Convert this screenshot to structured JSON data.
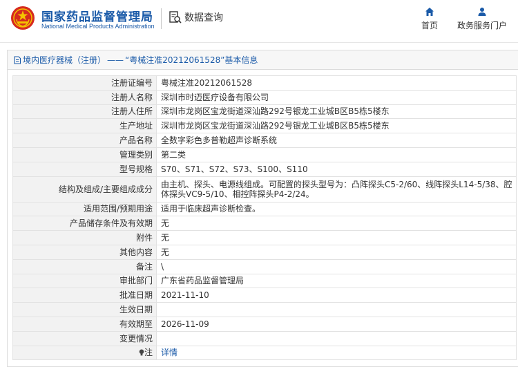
{
  "header": {
    "brand_cn": "国家药品监督管理局",
    "brand_en": "National Medical Products Administration",
    "query_label": "数据查询",
    "nav": {
      "home": "首页",
      "portal": "政务服务门户"
    },
    "colors": {
      "brand": "#1a5aa8",
      "emblem": "#d62b1e",
      "emblem_star": "#f4c300"
    }
  },
  "panel": {
    "breadcrumb": "境内医疗器械（注册）",
    "separator": "——",
    "title": "“粤械注准20212061528”基本信息"
  },
  "record": {
    "rows": [
      {
        "label": "注册证编号",
        "value": "粤械注准20212061528"
      },
      {
        "label": "注册人名称",
        "value": "深圳市时迈医疗设备有限公司"
      },
      {
        "label": "注册人住所",
        "value": "深圳市龙岗区宝龙街道深汕路292号银龙工业城B区B5栋5楼东"
      },
      {
        "label": "生产地址",
        "value": "深圳市龙岗区宝龙街道深汕路292号银龙工业城B区B5栋5楼东"
      },
      {
        "label": "产品名称",
        "value": "全数字彩色多普勒超声诊断系统"
      },
      {
        "label": "管理类别",
        "value": "第二类"
      },
      {
        "label": "型号规格",
        "value": "S70、S71、S72、S73、S100、S110"
      },
      {
        "label": "结构及组成/主要组成成分",
        "value": "由主机、探头、电源线组成。可配置的探头型号为：凸阵探头C5-2/60、线阵探头L14-5/38、腔体探头VC9-5/10、相控阵探头P4-2/24。"
      },
      {
        "label": "适用范围/预期用途",
        "value": "适用于临床超声诊断检查。"
      },
      {
        "label": "产品储存条件及有效期",
        "value": "无"
      },
      {
        "label": "附件",
        "value": "无"
      },
      {
        "label": "其他内容",
        "value": "无"
      },
      {
        "label": "备注",
        "value": "\\"
      },
      {
        "label": "审批部门",
        "value": "广东省药品监督管理局"
      },
      {
        "label": "批准日期",
        "value": "2021-11-10"
      },
      {
        "label": "生效日期",
        "value": ""
      },
      {
        "label": "有效期至",
        "value": "2026-11-09"
      },
      {
        "label": "变更情况",
        "value": ""
      }
    ],
    "note": {
      "label": "注",
      "link": "详情"
    }
  }
}
